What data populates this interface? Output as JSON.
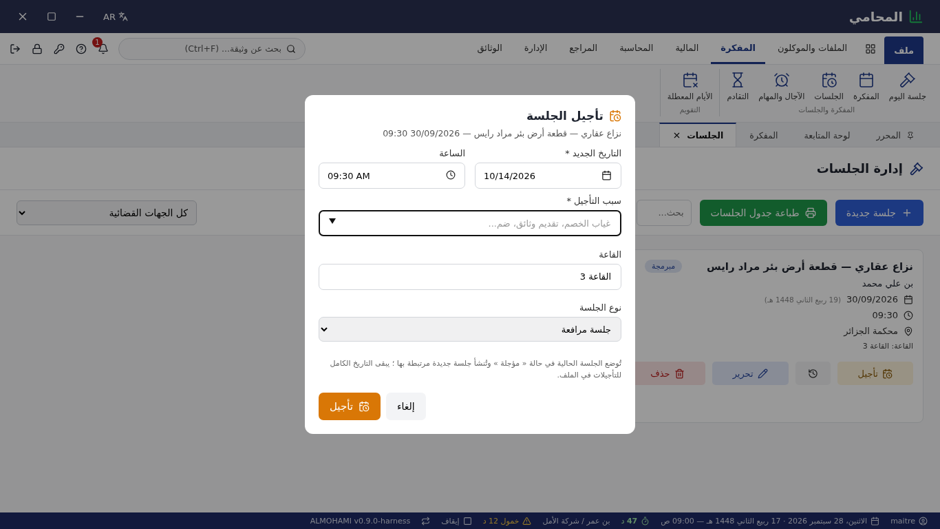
{
  "title_bar": {
    "app_name": "المحامي",
    "language": "AR"
  },
  "menu": {
    "file_button": "ملف",
    "tabs": [
      {
        "label": "الملفات والموكلون",
        "selected": false
      },
      {
        "label": "المفكرة",
        "selected": true
      },
      {
        "label": "المالية",
        "selected": false
      },
      {
        "label": "المحاسبة",
        "selected": false
      },
      {
        "label": "المراجع",
        "selected": false
      },
      {
        "label": "الإدارة",
        "selected": false
      },
      {
        "label": "الوثائق",
        "selected": false
      }
    ],
    "search": {
      "placeholder": "بحث عن وثيقة... (Ctrl+F)"
    },
    "notification_count": "1"
  },
  "ribbon": [
    {
      "label": "المفكرة والجلسات",
      "items": [
        "جلسة اليوم",
        "المفكرة",
        "الجلسات",
        "الآجال والمهام",
        "التقادم"
      ]
    },
    {
      "label": "التقويم",
      "items": [
        "الأيام المعطلة"
      ]
    }
  ],
  "doc_tabs": [
    {
      "label": "المحرر",
      "pinned": true,
      "closable": false,
      "selected": false
    },
    {
      "label": "لوحة المتابعة",
      "pinned": false,
      "closable": false,
      "selected": false
    },
    {
      "label": "المفكرة",
      "pinned": false,
      "closable": false,
      "selected": false
    },
    {
      "label": "الجلسات",
      "pinned": false,
      "closable": true,
      "selected": true
    }
  ],
  "page": {
    "heading": "إدارة الجلسات",
    "new_button": "جلسة جديدة",
    "print_button": "طباعة جدول الجلسات",
    "search": {
      "placeholder": "بحث..."
    },
    "court_filter": "كل الجهات القضائية"
  },
  "session_card": {
    "title": "نزاع عقاري — قطعة أرض بئر مراد رايس",
    "status": "مبرمجة",
    "client": "بن علي محمد",
    "date": "30/09/2026",
    "hijri": "(19 ربيع الثاني 1448 هـ)",
    "time": "09:30",
    "court": "محكمة الجزائر",
    "room": "القاعة: القاعة 3",
    "actions": [
      {
        "kind": "postpone",
        "label": "تأجيل"
      },
      {
        "kind": "history"
      },
      {
        "kind": "edit",
        "label": "تحرير"
      },
      {
        "kind": "delete",
        "label": "حذف"
      }
    ]
  },
  "dialog": {
    "title": "تأجيل الجلسة",
    "subtitle": "نزاع عقاري — قطعة أرض بئر مراد رايس — 30/09/2026 09:30",
    "date_label": "التاريخ الجديد *",
    "date_value": "10/14/2026",
    "time_label": "الساعة",
    "time_value": "09:30 AM",
    "reason_label": "سبب التأجيل *",
    "reason_placeholder": "غياب الخصم، تقديم وثائق، ضم...",
    "room_label": "القاعة",
    "room_value": "القاعة 3",
    "type_label": "نوع الجلسة",
    "type_value": "جلسة مرافعة",
    "note": "تُوضع الجلسة الحالية في حالة « مؤجلة » وتُنشأ جلسة جديدة مرتبطة بها ؛ يبقى التاريخ الكامل للتأجيلات في الملف.",
    "confirm_button": "تأجيل",
    "cancel_button": "إلغاء"
  },
  "status_bar": {
    "user": "maitre",
    "date": "الاثنين، 28 سبتمبر 2026 · 17 ربيع الثاني 1448 هـ — 09:00 ص",
    "timer": "**47** د",
    "office": "بن عمر / شركة الأمل",
    "idle": "خمول 12 د",
    "pause": {
      "label": "إيقاف",
      "checked": false
    },
    "version": "ALMOHAMI v0.9.0-harness"
  }
}
